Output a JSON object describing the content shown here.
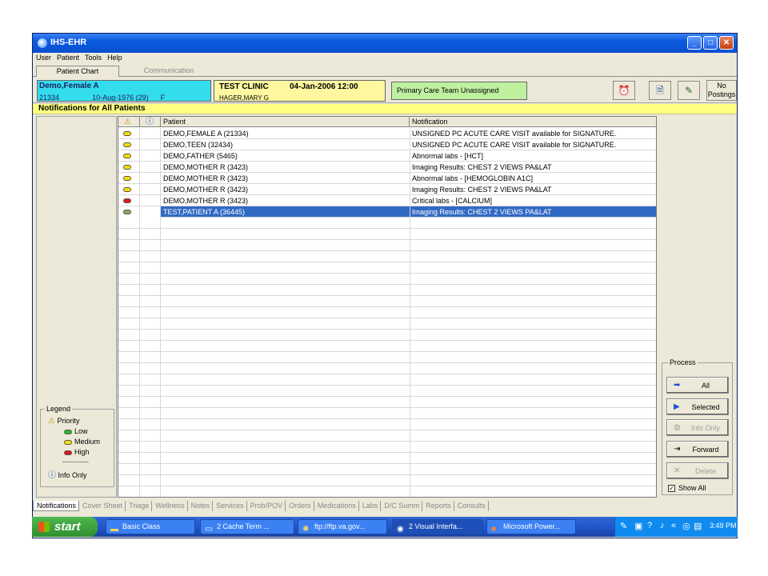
{
  "window": {
    "title": "IHS-EHR"
  },
  "menu": [
    "User",
    "Patient",
    "Tools",
    "Help"
  ],
  "top_tabs": [
    {
      "label": "Patient Chart",
      "active": true
    },
    {
      "label": "Communication",
      "active": false
    }
  ],
  "patient": {
    "name": "Demo,Female A",
    "id": "21334",
    "dob": "10-Aug-1976",
    "age": "(29)",
    "sex": "F"
  },
  "clinic": {
    "name": "TEST CLINIC",
    "datetime": "04-Jan-2006 12:00",
    "provider": "HAGER,MARY G"
  },
  "care_team": "Primary Care Team Unassigned",
  "postings": {
    "line1": "No",
    "line2": "Postings"
  },
  "notifications_title": "Notifications for All Patients",
  "grid": {
    "headers": [
      "Patient",
      "Notification"
    ],
    "rows": [
      {
        "patient": "DEMO,FEMALE A   (21334)",
        "notification": "UNSIGNED PC ACUTE CARE VISIT available for SIGNATURE.",
        "priority": "medium",
        "color": "#f5e000",
        "selected": false
      },
      {
        "patient": "DEMO,TEEN   (32434)",
        "notification": "UNSIGNED PC ACUTE CARE VISIT available for SIGNATURE.",
        "priority": "medium",
        "color": "#f5e000",
        "selected": false
      },
      {
        "patient": "DEMO,FATHER   (5465)",
        "notification": "Abnormal labs - [HCT]",
        "priority": "medium",
        "color": "#f5e000",
        "selected": false
      },
      {
        "patient": "DEMO,MOTHER R   (3423)",
        "notification": "Imaging Results: CHEST 2 VIEWS PA&LAT",
        "priority": "medium",
        "color": "#f5e000",
        "selected": false
      },
      {
        "patient": "DEMO,MOTHER R   (3423)",
        "notification": "Abnormal labs - [HEMOGLOBIN A1C]",
        "priority": "medium",
        "color": "#f5e000",
        "selected": false
      },
      {
        "patient": "DEMO,MOTHER R   (3423)",
        "notification": "Imaging Results: CHEST 2 VIEWS PA&LAT",
        "priority": "medium",
        "color": "#f5e000",
        "selected": false
      },
      {
        "patient": "DEMO,MOTHER R   (3423)",
        "notification": "Critical labs - [CALCIUM]",
        "priority": "high",
        "color": "#e01818",
        "selected": false
      },
      {
        "patient": "TEST,PATIENT A   (36445)",
        "notification": "Imaging Results: CHEST 2 VIEWS PA&LAT",
        "priority": "low",
        "color": "#8aaa5a",
        "selected": true
      }
    ]
  },
  "legend": {
    "title": "Legend",
    "priority_label": "Priority",
    "low": "Low",
    "medium": "Medium",
    "high": "High",
    "separator": "-----------",
    "info_only": "Info Only",
    "colors": {
      "low": "#22c022",
      "medium": "#f5e000",
      "high": "#e01818"
    }
  },
  "process": {
    "title": "Process",
    "buttons": [
      {
        "label": "All",
        "enabled": true
      },
      {
        "label": "Selected",
        "enabled": true
      },
      {
        "label": "Info Only",
        "enabled": false
      },
      {
        "label": "Forward",
        "enabled": true
      },
      {
        "label": "Delete",
        "enabled": false
      }
    ],
    "show_all": "Show All",
    "show_all_checked": true
  },
  "bottom_tabs": [
    "Notifications",
    "Cover Sheet",
    "Triage",
    "Wellness",
    "Notes",
    "Services",
    "Prob/POV",
    "Orders",
    "Medications",
    "Labs",
    "D/C Summ",
    "Reports",
    "Consults"
  ],
  "taskbar": {
    "start": "start",
    "tasks": [
      "Basic Class",
      "2 Cache Term ...",
      "ftp://ftp.va.gov...",
      "2 Visual Interfa...",
      "Microsoft Power..."
    ],
    "clock": "3:49 PM"
  }
}
